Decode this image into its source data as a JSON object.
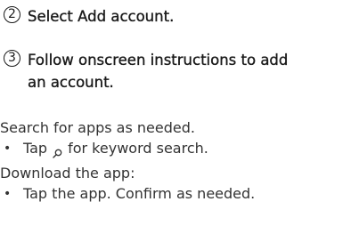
{
  "steps": [
    {
      "number": "2",
      "text": "Select Add account."
    },
    {
      "number": "3",
      "text_line1": "Follow onscreen instructions to add",
      "text_line2": "an account."
    }
  ],
  "search_intro": "Search for apps as needed.",
  "search_bullet": {
    "bullet": "•",
    "before": "Tap",
    "icon": "search-icon",
    "after": "for keyword search."
  },
  "download_intro": "Download the app:",
  "download_bullet": {
    "bullet": "•",
    "text": "Tap the app. Confirm as needed."
  }
}
